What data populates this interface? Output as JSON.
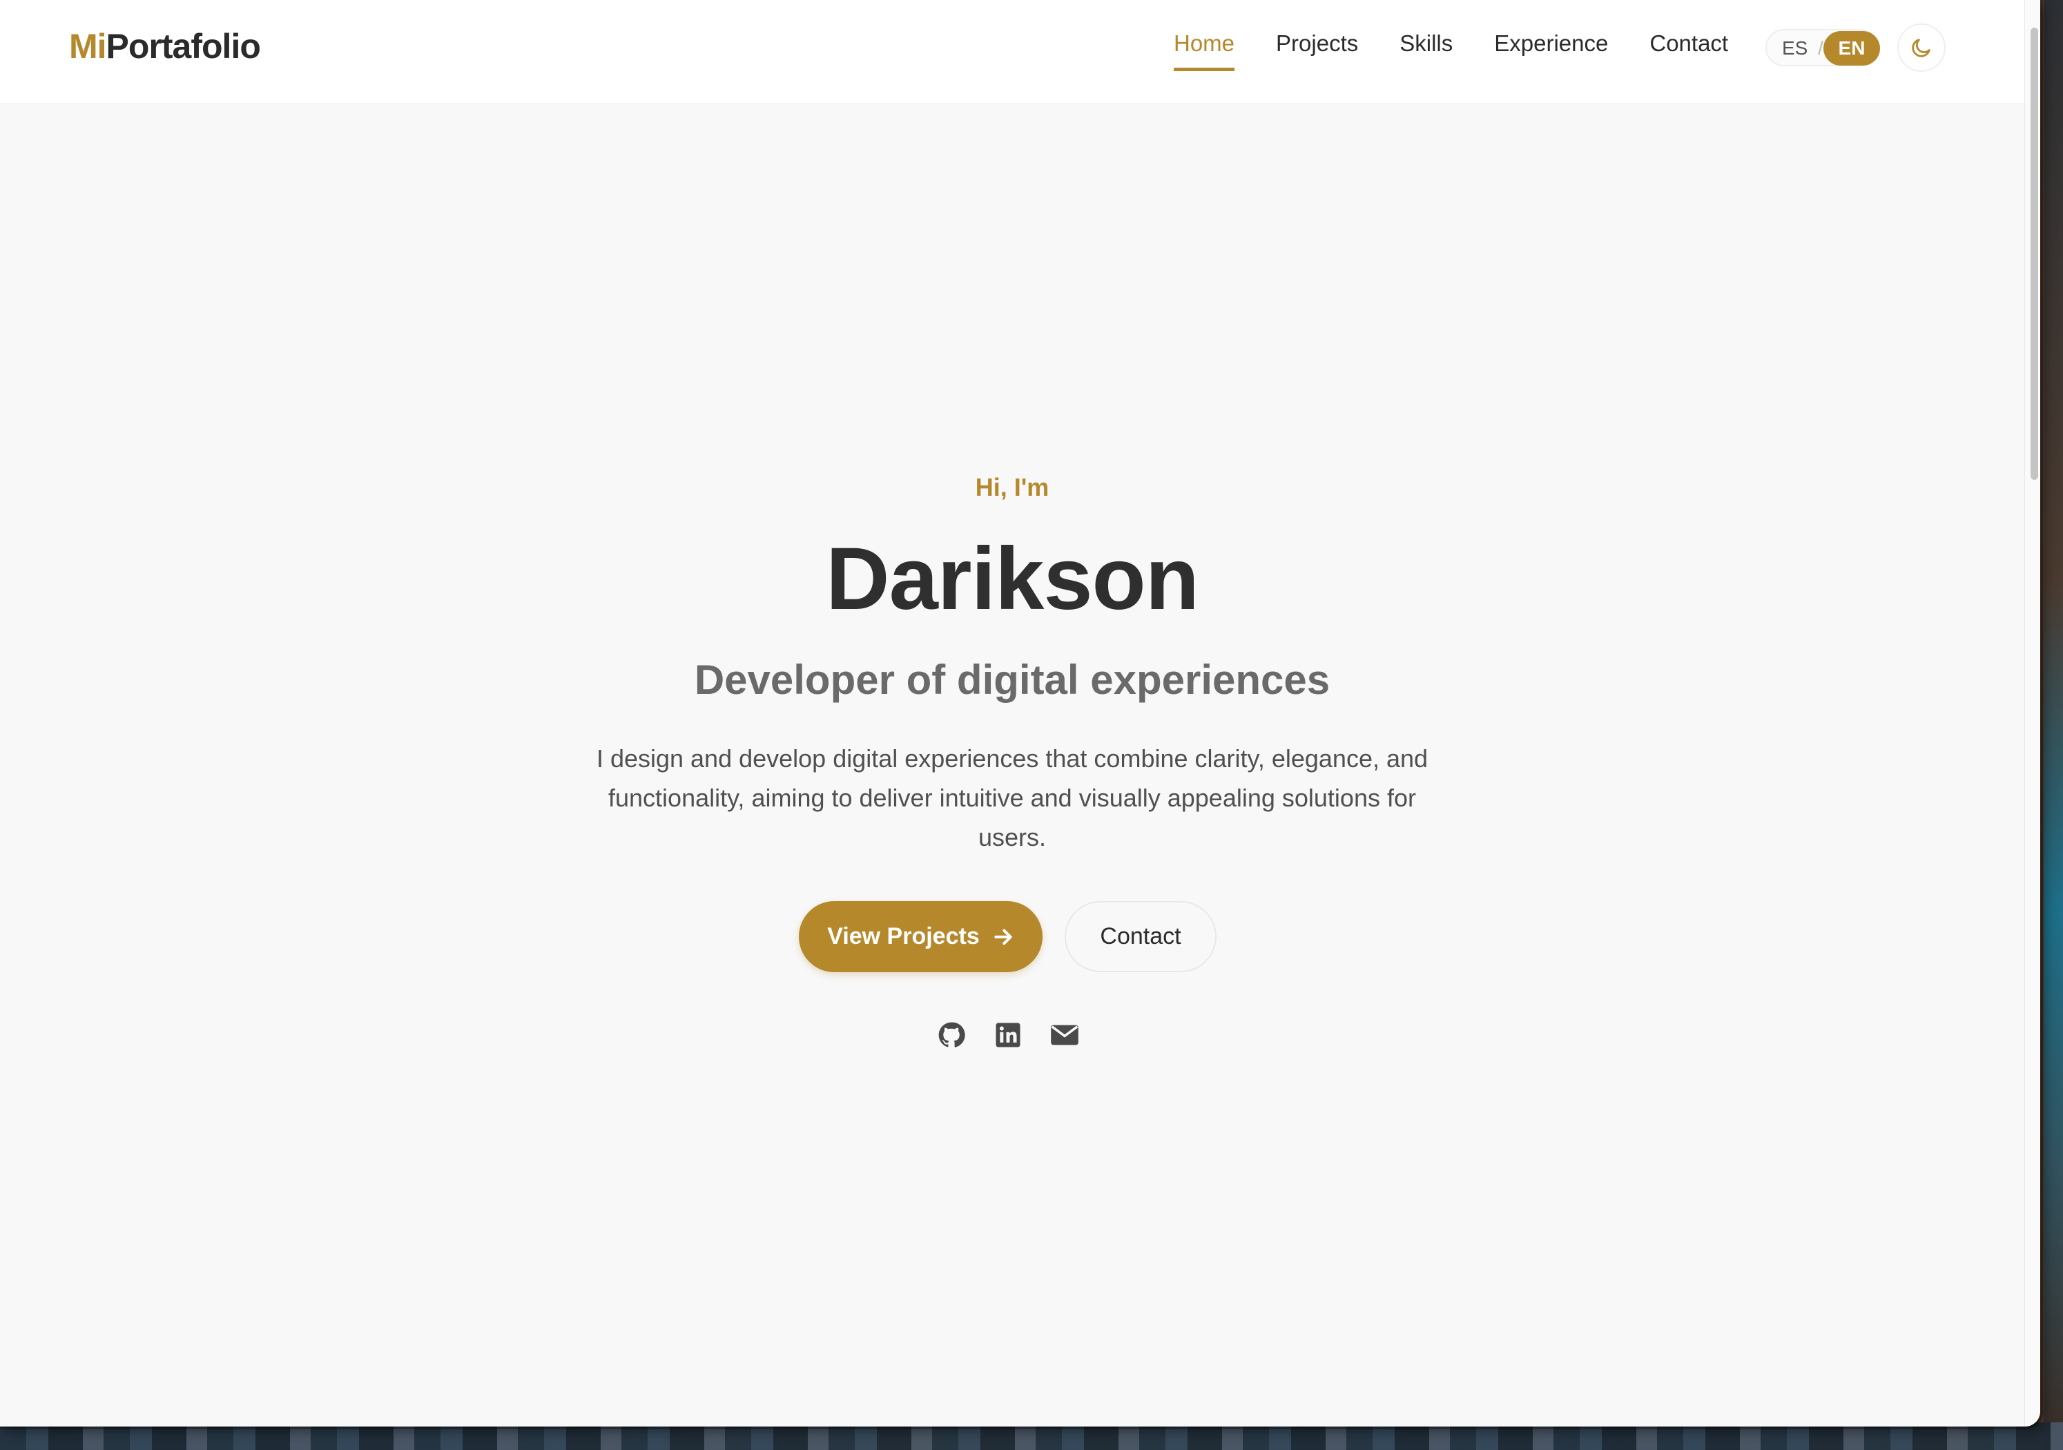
{
  "header": {
    "logo_accent": "Mi",
    "logo_rest": "Portafolio",
    "nav": [
      {
        "label": "Home",
        "active": true
      },
      {
        "label": "Projects",
        "active": false
      },
      {
        "label": "Skills",
        "active": false
      },
      {
        "label": "Experience",
        "active": false
      },
      {
        "label": "Contact",
        "active": false
      }
    ],
    "language": {
      "es": "ES",
      "separator": "/",
      "en": "EN",
      "selected": "EN"
    },
    "theme_toggle_icon": "moon-icon"
  },
  "hero": {
    "greeting": "Hi, I'm",
    "name": "Darikson",
    "subtitle": "Developer of digital experiences",
    "description": "I design and develop digital experiences that combine clarity, elegance, and functionality, aiming to deliver intuitive and visually appealing solutions for users.",
    "primary_button": "View Projects",
    "secondary_button": "Contact",
    "socials": [
      "github-icon",
      "linkedin-icon",
      "email-icon"
    ]
  },
  "colors": {
    "accent": "#b5892b",
    "text": "#2f2f2f",
    "muted": "#6a6a6a",
    "background": "#f8f8f8"
  }
}
